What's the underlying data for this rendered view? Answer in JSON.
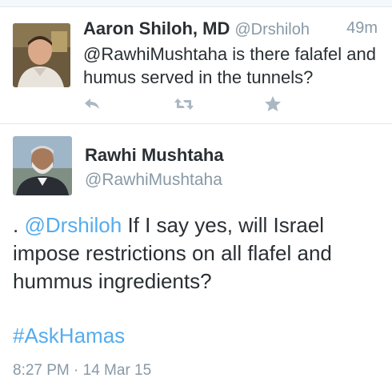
{
  "reply_tweet": {
    "author_name": "Aaron Shiloh, MD",
    "author_handle": "@Drshiloh",
    "time_ago": "49m",
    "text": "@RawhiMushtaha is there falafel and humus served in the tunnels?"
  },
  "main_tweet": {
    "author_name": "Rawhi Mushtaha",
    "author_handle": "@RawhiMushtaha",
    "text_prefix": ". ",
    "mention": "@Drshiloh",
    "text_body": " If I say yes, will Israel impose restrictions on all flafel and hummus ingredients?",
    "hashtag": "#AskHamas",
    "timestamp": "8:27 PM · 14 Mar 15"
  },
  "icons": {
    "reply": "reply-icon",
    "retweet": "retweet-icon",
    "favorite": "star-icon"
  },
  "colors": {
    "link": "#55acee",
    "muted": "#8899a6",
    "text": "#292f33",
    "action_icon": "#aab8c2"
  }
}
